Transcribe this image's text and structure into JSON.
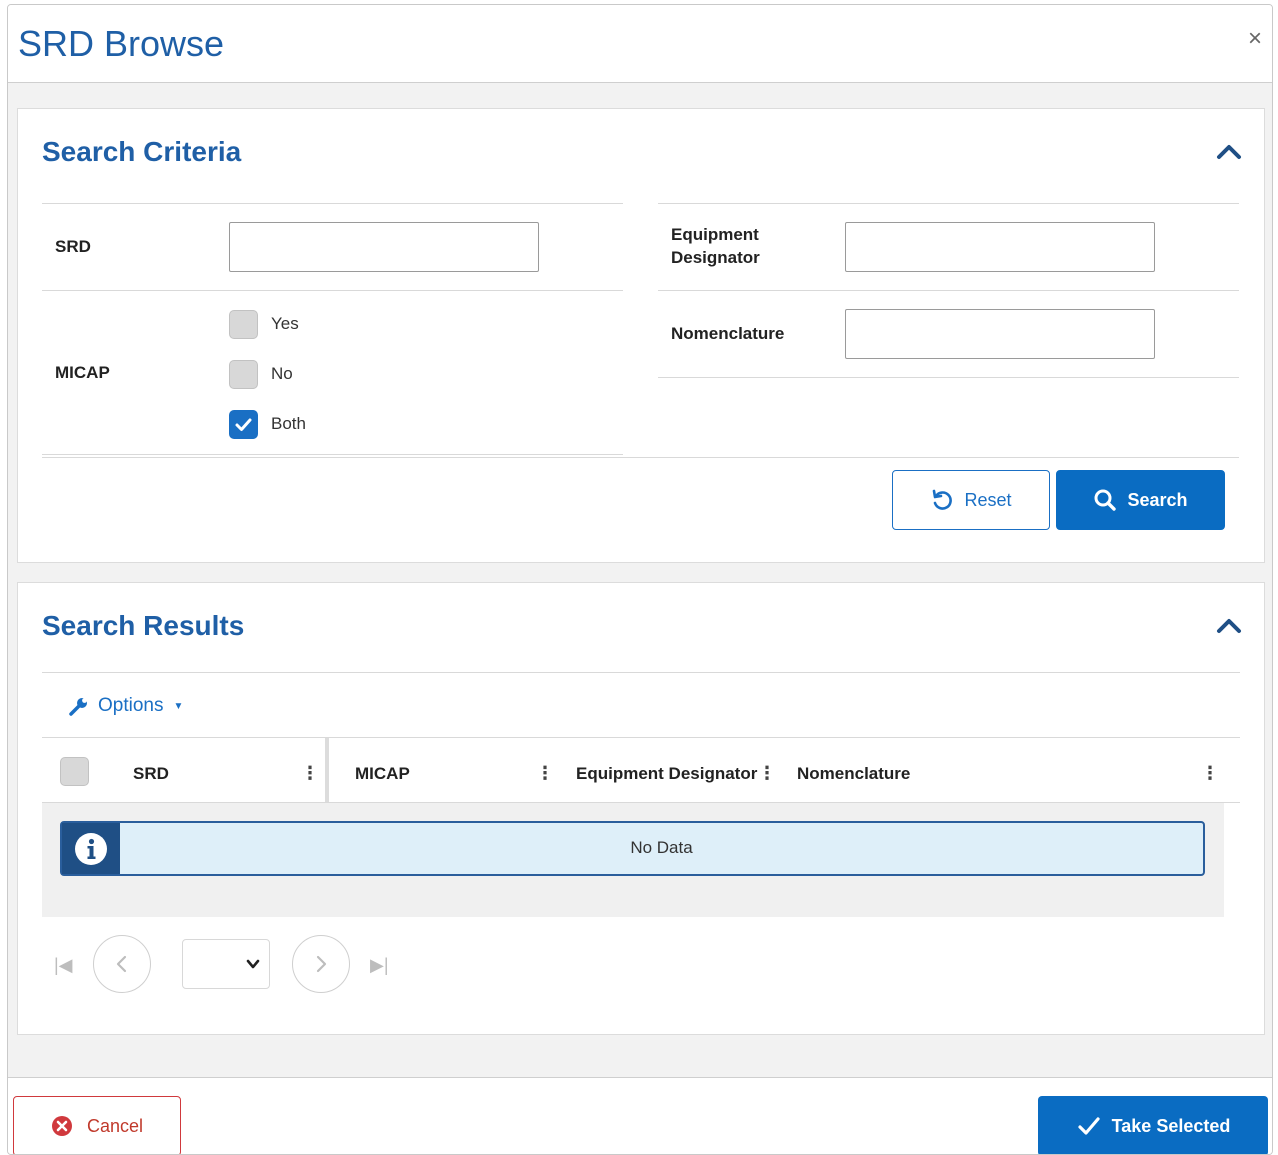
{
  "modal": {
    "title": "SRD Browse",
    "close_symbol": "×"
  },
  "search_criteria": {
    "title": "Search Criteria",
    "fields": {
      "srd_label": "SRD",
      "srd_value": "",
      "equipment_designator_label_line1": "Equipment",
      "equipment_designator_label_line2": "Designator",
      "equipment_designator_value": "",
      "micap_label": "MICAP",
      "nomenclature_label": "Nomenclature",
      "nomenclature_value": ""
    },
    "micap_options": [
      {
        "label": "Yes",
        "checked": false
      },
      {
        "label": "No",
        "checked": false
      },
      {
        "label": "Both",
        "checked": true
      }
    ],
    "reset_label": "Reset",
    "search_label": "Search"
  },
  "search_results": {
    "title": "Search Results",
    "options_label": "Options",
    "columns": [
      "SRD",
      "MICAP",
      "Equipment Designator",
      "Nomenclature"
    ],
    "rows": [],
    "no_data_text": "No Data",
    "pager": {
      "selected_page": ""
    }
  },
  "footer": {
    "cancel_label": "Cancel",
    "take_selected_label": "Take Selected"
  },
  "colors": {
    "primary": "#0a6cc2",
    "title_blue": "#1f5fa6",
    "danger": "#d0393d",
    "info_bg": "#deeff9"
  }
}
